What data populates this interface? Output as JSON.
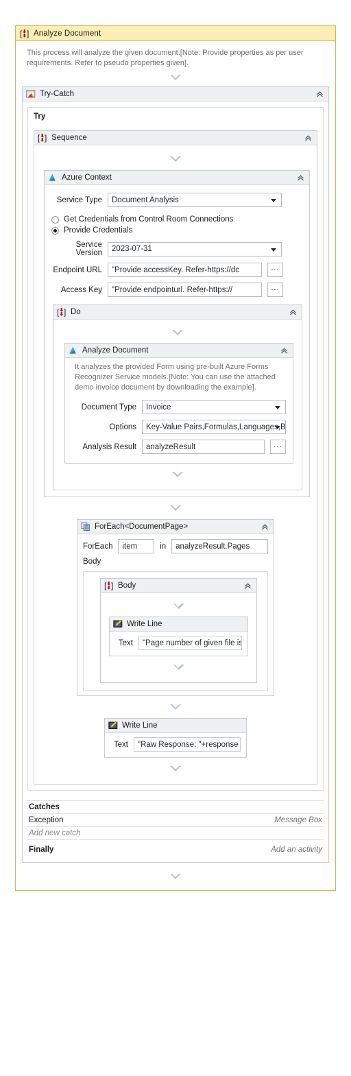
{
  "root": {
    "icon": "sequence-icon",
    "title": "Analyze Document",
    "description": "This process will analyze the given document.[Note: Provide properties as per user requirements. Refer to pseudo properties given]."
  },
  "try_catch": {
    "icon": "try-catch-icon",
    "title": "Try-Catch",
    "try_label": "Try",
    "catches_label": "Catches",
    "catch_exception_type": "Exception",
    "catch_exception_action": "Message Box",
    "add_new_catch": "Add new catch",
    "finally_label": "Finally",
    "finally_action": "Add an activity"
  },
  "sequence": {
    "icon": "sequence-icon",
    "title": "Sequence"
  },
  "azure_context": {
    "icon": "azure-icon",
    "title": "Azure Context",
    "fields": {
      "service_type_label": "Service Type",
      "service_type_value": "Document Analysis",
      "radio_control_room": "Get Credentials from Control Room Connections",
      "radio_provide_credentials": "Provide Credentials",
      "service_version_label": "Service Version",
      "service_version_value": "2023-07-31",
      "endpoint_url_label": "Endpoint URL",
      "endpoint_url_value": "\"Provide accessKey. Refer-https://dc",
      "access_key_label": "Access Key",
      "access_key_value": "\"Provide endpointurl. Refer-https://",
      "ellipsis": "..."
    }
  },
  "do_block": {
    "icon": "sequence-icon",
    "title": "Do"
  },
  "analyze_document": {
    "icon": "azure-icon",
    "title": "Analyze Document",
    "description": "It analyzes the provided Form using pre-built Azure Forms Recognizer Service models.[Note: You can use the attached demo invoice document by downloading the example].",
    "fields": {
      "document_type_label": "Document Type",
      "document_type_value": "Invoice",
      "options_label": "Options",
      "options_value": "Key-Value Pairs,Formulas,Languages,Barco",
      "analysis_result_label": "Analysis Result",
      "analysis_result_value": "analyzeResult",
      "ellipsis": "..."
    }
  },
  "foreach": {
    "icon": "foreach-icon",
    "title": "ForEach<DocumentPage>",
    "foreach_label": "ForEach",
    "item_value": "item",
    "in_label": "in",
    "collection_value": "analyzeResult.Pages",
    "body_label": "Body"
  },
  "foreach_body": {
    "icon": "sequence-icon",
    "title": "Body"
  },
  "write_line_inner": {
    "icon": "write-line-icon",
    "title": "Write Line",
    "text_label": "Text",
    "text_value": "\"Page number of  given file is"
  },
  "write_line_outer": {
    "icon": "write-line-icon",
    "title": "Write Line",
    "text_label": "Text",
    "text_value": "\"Raw Response: \"+response"
  },
  "colors": {
    "root_border": "#d7b45a",
    "root_header_bg": "#fdeeb8",
    "card_header_bg": "#eef0f3",
    "card_border": "#c9ccd1",
    "azure_blue": "#0089d6",
    "sequence_red": "#c00000",
    "arrow_grey": "#b9c4d2"
  }
}
